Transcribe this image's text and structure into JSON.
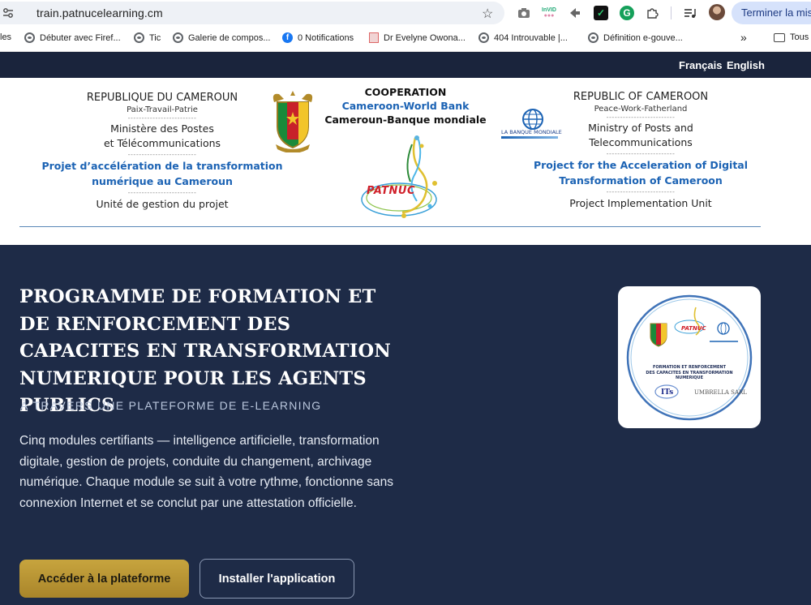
{
  "browser": {
    "url": "train.patnucelearning.cm",
    "update_button": "Terminer la mise",
    "bookmarks": [
      {
        "label": "les",
        "icon": "none"
      },
      {
        "label": "Débuter avec Firef...",
        "icon": "globe-icon"
      },
      {
        "label": "Tic",
        "icon": "globe-icon"
      },
      {
        "label": "Galerie de compos...",
        "icon": "globe-icon"
      },
      {
        "label": "0 Notifications",
        "icon": "facebook-icon"
      },
      {
        "label": "Dr Evelyne Owona...",
        "icon": "pdf-icon"
      },
      {
        "label": "404 Introuvable |...",
        "icon": "globe-icon"
      },
      {
        "label": "Définition e-gouve...",
        "icon": "globe-icon"
      }
    ],
    "more_bookmarks": "»",
    "all_bookmarks_folder": "Tous"
  },
  "nav": {
    "lang_fr": "Français",
    "lang_en": "English"
  },
  "header": {
    "left": {
      "country": "REPUBLIQUE DU CAMEROUN",
      "motto": "Paix-Travail-Patrie",
      "ministry_line1": "Ministère des Postes",
      "ministry_line2": "et Télécommunications",
      "project_line1": "Projet d’accélération de la transformation",
      "project_line2": "numérique au Cameroun",
      "unit": "Unité de gestion du projet"
    },
    "center": {
      "cooperation": "COOPERATION",
      "line_en": "Cameroon-World Bank",
      "line_fr": "Cameroun-Banque mondiale",
      "logo_text": "PATNUC"
    },
    "right": {
      "country": "REPUBLIC OF CAMEROON",
      "motto": "Peace-Work-Fatherland",
      "ministry_line1": "Ministry of Posts and",
      "ministry_line2": "Telecommunications",
      "project_line1": "Project for the Acceleration of Digital",
      "project_line2": "Transformation of Cameroon",
      "unit": "Project Implementation Unit",
      "worldbank_logo_text": "LA BANQUE MONDIALE"
    },
    "separator": "-------------------------"
  },
  "hero": {
    "title": "PROGRAMME DE FORMATION ET DE RENFORCEMENT DES CAPACITES EN TRANSFORMATION NUMERIQUE POUR LES AGENTS PUBLICS",
    "subtitle": "À TRAVERS UNE PLATEFORME DE E-LEARNING",
    "description": "Cinq modules certifiants — intelligence artificielle, transformation digitale, gestion de projets, conduite du changement, archivage numérique. Chaque module se suit à votre rythme, fonctionne sans connexion Internet et se conclut par une attestation officielle.",
    "primary_button": "Accéder à la plateforme",
    "secondary_button": "Installer l'application",
    "badge": {
      "title_line1": "FORMATION ET RENFORCEMENT",
      "title_line2": "DES CAPACITES EN TRANSFORMATION NUMERIQUE",
      "partner1": "ITs",
      "partner2": "UMBRELLA SARL"
    }
  },
  "colors": {
    "navy": "#1e2b47",
    "nav_bar": "#1a243c",
    "accent_gold": "#b8952f",
    "link_blue": "#1c63b4"
  }
}
